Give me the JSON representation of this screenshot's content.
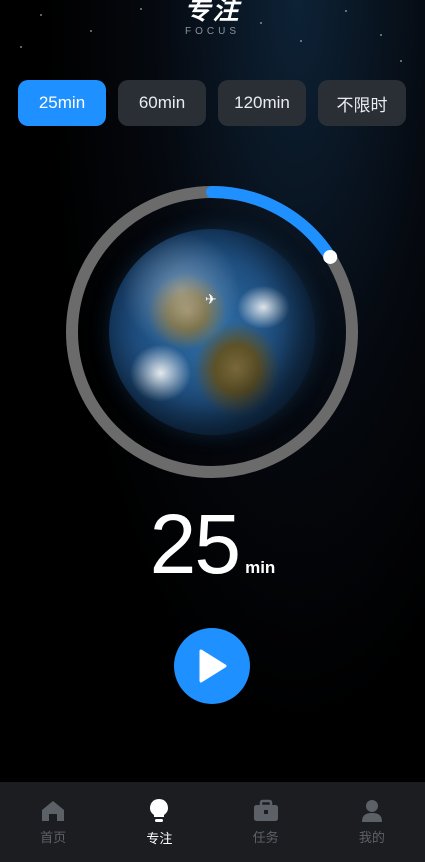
{
  "header": {
    "title": "专注",
    "subtitle": "FOCUS"
  },
  "durations": [
    {
      "label": "25min",
      "active": true
    },
    {
      "label": "60min",
      "active": false
    },
    {
      "label": "120min",
      "active": false
    },
    {
      "label": "不限时",
      "active": false
    }
  ],
  "progress": {
    "fraction": 0.16,
    "track_color": "#6b6b6b",
    "fill_color": "#1e90ff"
  },
  "timer": {
    "value": "25",
    "unit": "min"
  },
  "play_button": {
    "icon": "play-icon",
    "color": "#1e90ff"
  },
  "nav": [
    {
      "label": "首页",
      "icon": "home-icon",
      "active": false
    },
    {
      "label": "专注",
      "icon": "lightbulb-icon",
      "active": true
    },
    {
      "label": "任务",
      "icon": "briefcase-icon",
      "active": false
    },
    {
      "label": "我的",
      "icon": "user-icon",
      "active": false
    }
  ]
}
